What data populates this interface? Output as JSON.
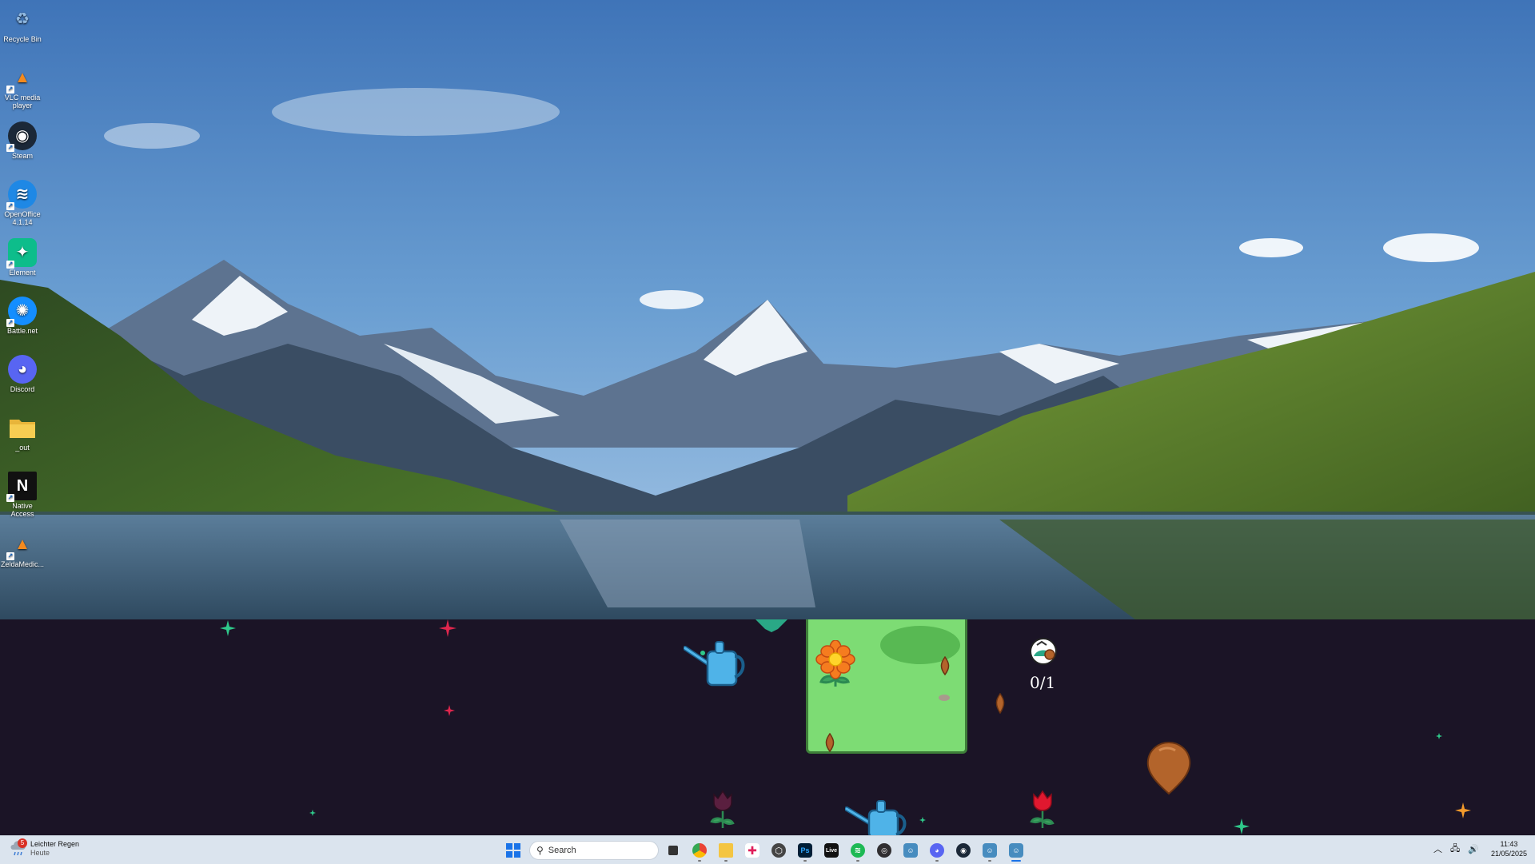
{
  "desktop": {
    "icons": [
      {
        "label": "Recycle Bin",
        "icon": "recycle-bin-icon",
        "color": "#8fb8e0",
        "glyph": "♻",
        "shortcut": false
      },
      {
        "label": "VLC media player",
        "icon": "vlc-icon",
        "color": "#f48a1e",
        "glyph": "▲",
        "shortcut": true
      },
      {
        "label": "Steam",
        "icon": "steam-icon",
        "color": "#1b2838",
        "glyph": "◉",
        "shortcut": true
      },
      {
        "label": "OpenOffice 4.1.14",
        "icon": "openoffice-icon",
        "color": "#1e88e5",
        "glyph": "≋",
        "shortcut": true
      },
      {
        "label": "Element",
        "icon": "element-icon",
        "color": "#0dbd8b",
        "glyph": "✦",
        "shortcut": true
      },
      {
        "label": "Battle.net",
        "icon": "battlenet-icon",
        "color": "#148eff",
        "glyph": "✺",
        "shortcut": true
      },
      {
        "label": "Discord",
        "icon": "discord-icon",
        "color": "#5865f2",
        "glyph": "◕",
        "shortcut": false
      },
      {
        "label": "_out",
        "icon": "folder-icon",
        "color": "#f4c542",
        "glyph": "",
        "shortcut": false
      },
      {
        "label": "Native Access",
        "icon": "native-access-icon",
        "color": "#111111",
        "glyph": "N",
        "shortcut": true
      },
      {
        "label": "ZeldaMedic...",
        "icon": "vlc-icon",
        "color": "#f48a1e",
        "glyph": "▲",
        "shortcut": true
      }
    ]
  },
  "game": {
    "counter": "0/1",
    "colors": {
      "background": "#1b1426",
      "plot": "#7ddc74",
      "water_can": "#4fb3e8",
      "seed": "#b3642b"
    }
  },
  "taskbar": {
    "weather": {
      "title": "Leichter Regen",
      "subtitle": "Heute",
      "badge": "5"
    },
    "search_placeholder": "Search",
    "apps": [
      {
        "name": "taskview-icon",
        "label": "",
        "color": "#333333",
        "active": false,
        "running": false
      },
      {
        "name": "chrome-icon",
        "label": "",
        "color": "#ea4335",
        "active": false,
        "running": true
      },
      {
        "name": "file-explorer-icon",
        "label": "",
        "color": "#f4c542",
        "active": false,
        "running": true
      },
      {
        "name": "slack-icon",
        "label": "",
        "color": "#4a154b",
        "active": false,
        "running": false
      },
      {
        "name": "unity-icon",
        "label": "",
        "color": "#444444",
        "active": false,
        "running": false
      },
      {
        "name": "photoshop-icon",
        "label": "Ps",
        "color": "#001e36",
        "active": false,
        "running": true
      },
      {
        "name": "live-icon",
        "label": "Live",
        "color": "#111111",
        "active": false,
        "running": false
      },
      {
        "name": "spotify-icon",
        "label": "",
        "color": "#1db954",
        "active": false,
        "running": true
      },
      {
        "name": "obs-icon",
        "label": "",
        "color": "#302e31",
        "active": false,
        "running": false
      },
      {
        "name": "godot-icon",
        "label": "",
        "color": "#478cbf",
        "active": false,
        "running": false
      },
      {
        "name": "discord-icon",
        "label": "",
        "color": "#5865f2",
        "active": false,
        "running": true
      },
      {
        "name": "steam-icon",
        "label": "",
        "color": "#1b2838",
        "active": false,
        "running": false
      },
      {
        "name": "godot-icon",
        "label": "",
        "color": "#478cbf",
        "active": false,
        "running": true
      },
      {
        "name": "godot-game-icon",
        "label": "",
        "color": "#478cbf",
        "active": true,
        "running": true
      }
    ],
    "clock": {
      "time": "11:43",
      "date": "21/05/2025"
    }
  }
}
